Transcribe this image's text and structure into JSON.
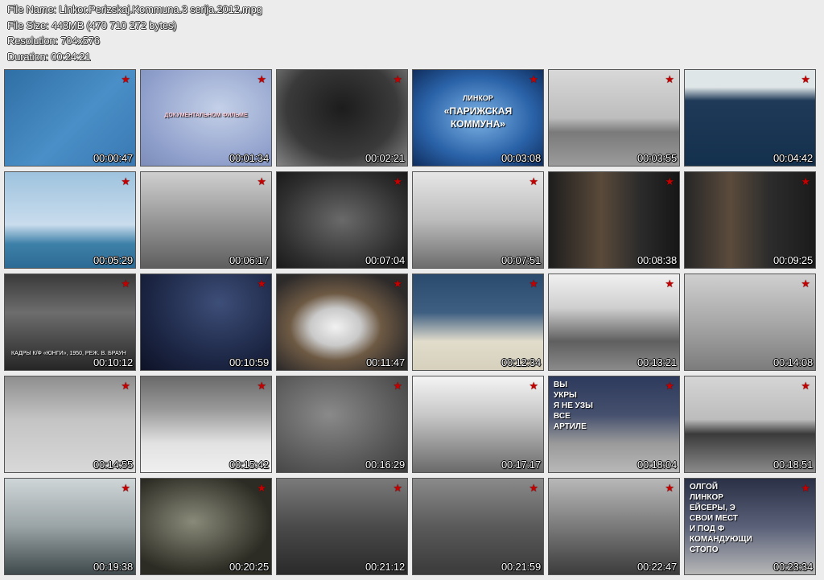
{
  "file_info": {
    "file_name": "File Name: Linkor.Perizskaj.Kommuna.3 serija.2012.mpg",
    "file_size": "File Size: 448MB (470 710 272 bytes)",
    "resolution": "Resolution: 704x576",
    "duration": "Duration: 00:24:21"
  },
  "thumbnails": [
    {
      "time": "00:00:47"
    },
    {
      "time": "00:01:34",
      "overlay": "ДОКУМЕНТАЛЬНОМ ФИЛЬМЕ"
    },
    {
      "time": "00:02:21"
    },
    {
      "time": "00:03:08",
      "overlay_top": "ЛИНКОР",
      "overlay_mid": "«ПАРИЖСКАЯ",
      "overlay_bot": "КОММУНА»"
    },
    {
      "time": "00:03:55"
    },
    {
      "time": "00:04:42"
    },
    {
      "time": "00:05:29"
    },
    {
      "time": "00:06:17"
    },
    {
      "time": "00:07:04"
    },
    {
      "time": "00:07:51"
    },
    {
      "time": "00:08:38"
    },
    {
      "time": "00:09:25"
    },
    {
      "time": "00:10:12",
      "overlay": "КАДРЫ К/Ф «ЮНГИ», 1950, РЕЖ. В. БРАУН"
    },
    {
      "time": "00:10:59"
    },
    {
      "time": "00:11:47"
    },
    {
      "time": "00:12:34"
    },
    {
      "time": "00:13:21"
    },
    {
      "time": "00:14:08"
    },
    {
      "time": "00:14:55"
    },
    {
      "time": "00:15:42"
    },
    {
      "time": "00:16:29"
    },
    {
      "time": "00:17:17"
    },
    {
      "time": "00:18:04",
      "poster": "ВЫ\nУКРЫ\nЯ НЕ УЗЫ\nВСЕ\nАРТИЛЕ"
    },
    {
      "time": "00:18:51"
    },
    {
      "time": "00:19:38"
    },
    {
      "time": "00:20:25"
    },
    {
      "time": "00:21:12"
    },
    {
      "time": "00:21:59"
    },
    {
      "time": "00:22:47"
    },
    {
      "time": "00:23:34",
      "poster": "ОЛГОЙ\nЛИНКОР\nЕЙСЕРЫ, Э\nСВОИ МЕСТ\nИ ПОД Ф\nКОМАНДУЮЩИ\nСТОПО"
    }
  ],
  "badge": {
    "icon": "star-icon",
    "glyph": "★",
    "color": "#c40000"
  }
}
